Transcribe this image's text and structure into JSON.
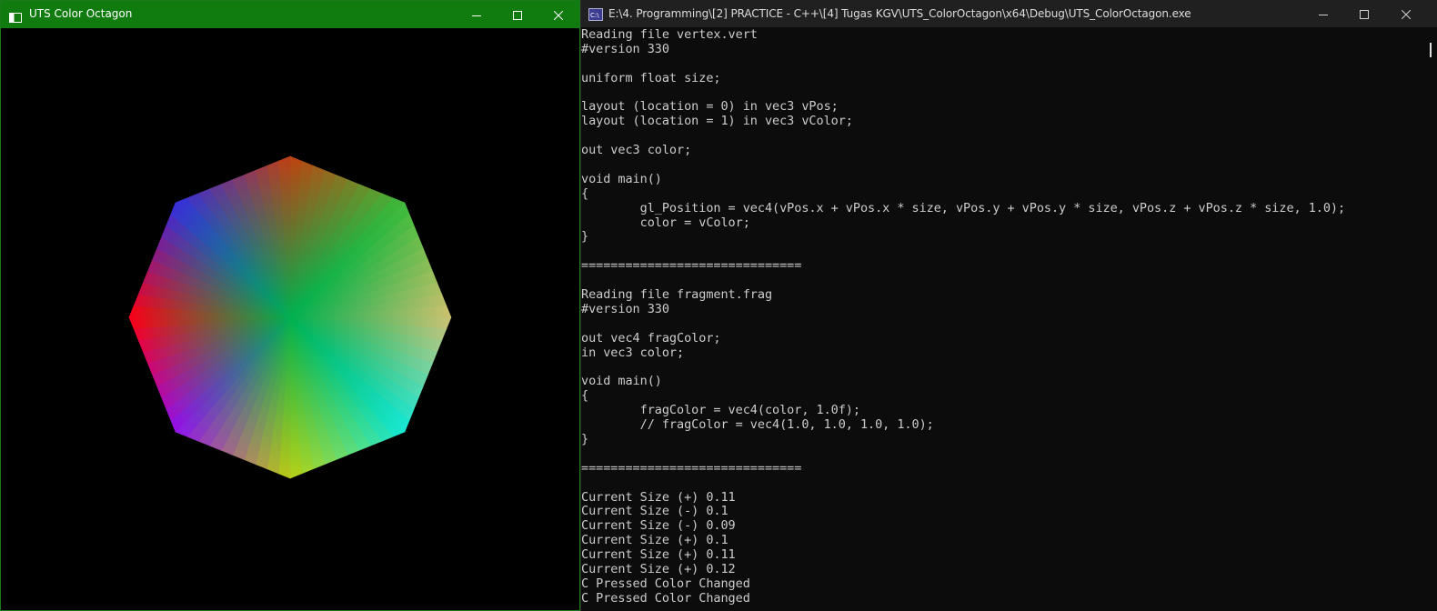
{
  "gl_window": {
    "title": "UTS Color Octagon",
    "accent": "#107c10",
    "icons": {
      "app": "window-app-icon",
      "minimize": "minimize-icon",
      "maximize": "maximize-icon",
      "close": "close-icon"
    }
  },
  "console_window": {
    "title": "E:\\4. Programming\\[2] PRACTICE - C++\\[4] Tugas KGV\\UTS_ColorOctagon\\x64\\Debug\\UTS_ColorOctagon.exe",
    "icons": {
      "app": "console-app-icon",
      "minimize": "minimize-icon",
      "maximize": "maximize-icon",
      "close": "close-icon"
    },
    "lines": [
      "Reading file vertex.vert",
      "#version 330",
      "",
      "uniform float size;",
      "",
      "layout (location = 0) in vec3 vPos;",
      "layout (location = 1) in vec3 vColor;",
      "",
      "out vec3 color;",
      "",
      "void main()",
      "{",
      "        gl_Position = vec4(vPos.x + vPos.x * size, vPos.y + vPos.y * size, vPos.z + vPos.z * size, 1.0);",
      "        color = vColor;",
      "}",
      "",
      "==============================",
      "",
      "Reading file fragment.frag",
      "#version 330",
      "",
      "out vec4 fragColor;",
      "in vec3 color;",
      "",
      "void main()",
      "{",
      "        fragColor = vec4(color, 1.0f);",
      "        // fragColor = vec4(1.0, 1.0, 1.0, 1.0);",
      "}",
      "",
      "==============================",
      "",
      "Current Size (+) 0.11",
      "Current Size (-) 0.1",
      "Current Size (-) 0.09",
      "Current Size (+) 0.1",
      "Current Size (+) 0.11",
      "Current Size (+) 0.12",
      "C Pressed Color Changed",
      "C Pressed Color Changed"
    ]
  },
  "octagon": {
    "center_color": "#00b050",
    "vertex_colors": [
      "#c04010",
      "#3aba3a",
      "#d0c070",
      "#10e8d8",
      "#b8d010",
      "#9010f0",
      "#ff0010",
      "#3030e0"
    ]
  }
}
